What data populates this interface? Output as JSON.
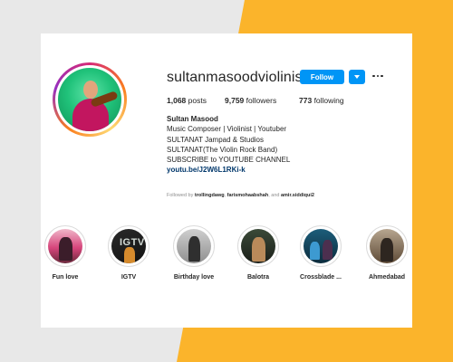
{
  "profile": {
    "username": "sultanmasoodviolinist",
    "follow_label": "Follow",
    "stats": [
      {
        "value": "1,068",
        "label": "posts"
      },
      {
        "value": "9,759",
        "label": "followers"
      },
      {
        "value": "773",
        "label": "following"
      }
    ],
    "bio": {
      "name": "Sultan Masood",
      "lines": [
        "Music Composer | Violinist | Youtuber",
        "SULTANAT Jampad & Studios",
        "SULTANAT(The Violin Rock Band)",
        "SUBSCRIBE to YOUTUBE CHANNEL"
      ],
      "link": "youtu.be/J2W6L1RKi-k"
    },
    "followed_by": {
      "prefix": "Followed by",
      "user1": "trollingdawg",
      "user2": "farismohaabshah",
      "and_text": ", and",
      "user3": "amir.siddiqui2"
    }
  },
  "highlights": [
    {
      "label": "Fun love"
    },
    {
      "label": "IGTV",
      "overlay": "IGTV"
    },
    {
      "label": "Birthday love"
    },
    {
      "label": "Balotra"
    },
    {
      "label": "Crossblade ..."
    },
    {
      "label": "Ahmedabad"
    }
  ],
  "colors": {
    "accent": "#0095f6",
    "link": "#00376b",
    "background_yellow": "#fbb42b",
    "background_gray": "#e8e8e8"
  },
  "icons": {
    "dropdown": "chevron-down-icon",
    "more": "more-options-icon"
  }
}
